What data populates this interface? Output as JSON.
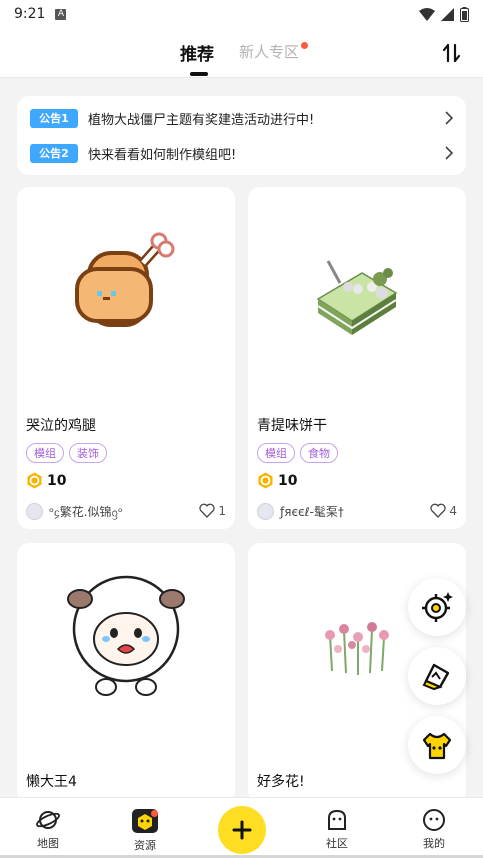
{
  "status_bar": {
    "time": "9:21",
    "sim_label": "A"
  },
  "top_nav": {
    "tab_recommended": "推荐",
    "tab_newbie": "新人专区"
  },
  "announcements": [
    {
      "badge": "公告1",
      "text": "植物大战僵尸主题有奖建造活动进行中!"
    },
    {
      "badge": "公告2",
      "text": "快来看看如何制作模组吧!"
    }
  ],
  "cards": [
    {
      "title": "哭泣的鸡腿",
      "tags": [
        "模组",
        "装饰"
      ],
      "price": "10",
      "author": "ᵒ᧔繁花.似锦ᦋᵒ",
      "likes": "1"
    },
    {
      "title": "青提味饼干",
      "tags": [
        "模组",
        "食物"
      ],
      "price": "10",
      "author": "ƒяєєℓ-髦䂞†",
      "likes": "4"
    },
    {
      "title": "懒大王4"
    },
    {
      "title": "好多花!"
    }
  ],
  "bottom_nav": {
    "map": "地图",
    "resources": "资源",
    "community": "社区",
    "mine": "我的"
  },
  "colors": {
    "accent_yellow": "#ffdd22",
    "badge_blue": "#3ea7ff",
    "tag_purple": "#a15fd8",
    "dot_red": "#ff5a3c"
  }
}
